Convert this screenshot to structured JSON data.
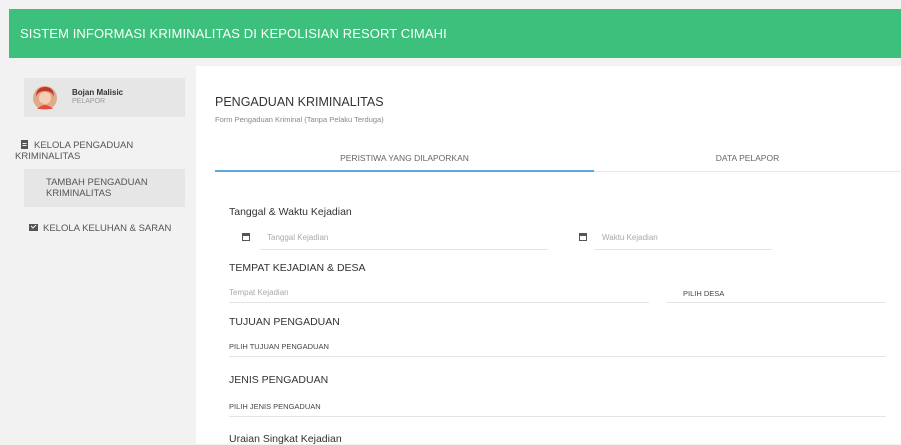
{
  "header": {
    "title": "SISTEM INFORMASI KRIMINALITAS DI KEPOLISIAN RESORT CIMAHI"
  },
  "user": {
    "name": "Bojan Malisic",
    "role": "PELAPOR"
  },
  "sidebar": {
    "items": [
      {
        "label": "KELOLA PENGADUAN KRIMINALITAS",
        "icon": "document-icon"
      },
      {
        "label": "TAMBAH PENGADUAN KRIMINALITAS"
      },
      {
        "label": "KELOLA KELUHAN & SARAN",
        "icon": "message-icon"
      }
    ]
  },
  "page": {
    "title": "PENGADUAN KRIMINALITAS",
    "subtitle": "Form Pengaduan Kriminal (Tanpa Pelaku Terduga)"
  },
  "tabs": [
    {
      "label": "PERISTIWA YANG DILAPORKAN",
      "active": true
    },
    {
      "label": "DATA PELAPOR",
      "active": false
    }
  ],
  "form": {
    "datetime_label": "Tanggal & Waktu Kejadian",
    "date_placeholder": "Tanggal Kejadian",
    "time_placeholder": "Waktu Kejadian",
    "place_label": "TEMPAT KEJADIAN & DESA",
    "place_placeholder": "Tempat Kejadian",
    "desa_select": "PILIH DESA",
    "tujuan_label": "TUJUAN PENGADUAN",
    "tujuan_select": "PILIH TUJUAN PENGADUAN",
    "jenis_label": "JENIS PENGADUAN",
    "jenis_select": "PILIH JENIS PENGADUAN",
    "uraian_label": "Uraian Singkat Kejadian"
  },
  "colors": {
    "header": "#3cc07b",
    "tab_active": "#5aa8e0"
  }
}
